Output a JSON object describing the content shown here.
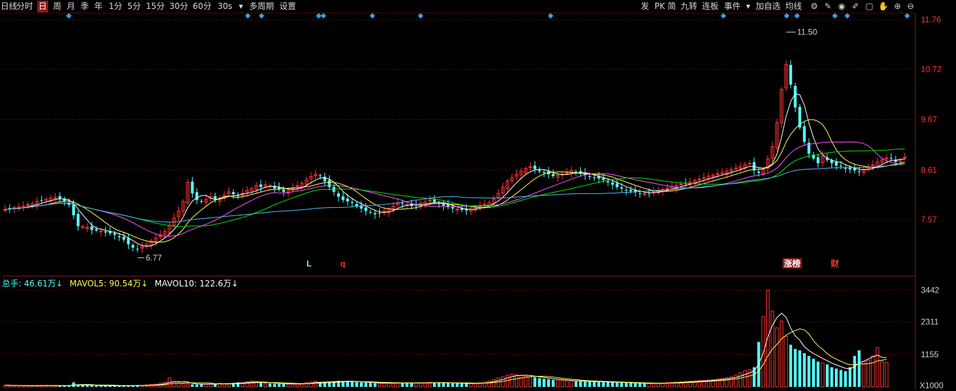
{
  "toolbar": {
    "period_buttons": [
      "日线",
      "分时",
      "日",
      "周",
      "月",
      "季",
      "年",
      "1分",
      "5分",
      "15分",
      "30分",
      "60分",
      "30s"
    ],
    "active_period": "日",
    "dropdown_arrow": "▾",
    "multi_period": "多周期",
    "settings": "设置",
    "right_buttons": [
      "发",
      "PK",
      "简",
      "九转",
      "连板",
      "事件"
    ],
    "add_watchlist": "加自选",
    "ma_line": "均线",
    "right_icons": [
      "settings-icon",
      "pen-icon",
      "eye-icon",
      "draw-icon",
      "box-icon",
      "hand-icon",
      "zoom-in-icon",
      "zoom-out-icon"
    ]
  },
  "colors": {
    "up": "#ff3232",
    "down": "#54ffff",
    "ma5": "#ffffff",
    "ma10": "#ffff54",
    "ma20": "#ff54ff",
    "ma30": "#00e600",
    "ma60": "#54b6ff",
    "grid": "#7a0000",
    "axis_text": "#ff3232"
  },
  "chart_data": {
    "type": "candlestick",
    "price_axis": {
      "ticks": [
        "11.76",
        "10.72",
        "9.67",
        "8.61",
        "7.57"
      ],
      "values": [
        11.76,
        10.72,
        9.67,
        8.61,
        7.57
      ],
      "ylim": [
        6.5,
        11.9
      ]
    },
    "annotations": {
      "high_label": "11.50",
      "high_value": 11.5,
      "low_label": "6.77",
      "low_value": 6.77
    },
    "markers": [
      {
        "text": "L",
        "color": "#54ffff"
      },
      {
        "text": "q",
        "color": "#ff3232"
      },
      {
        "text": "涨榜",
        "color": "#ffffff",
        "bg": "#8b1a1a"
      },
      {
        "text": "财",
        "color": "#ff3232"
      }
    ],
    "volume_header": {
      "total": "总手: 46.61万↓",
      "mavol5": "MAVOL5: 90.54万↓",
      "mavol10": "MAVOL10: 122.6万↓"
    },
    "volume_axis": {
      "ticks": [
        "3442",
        "2311",
        "1155"
      ],
      "values": [
        3442,
        2311,
        1155
      ],
      "unit": "X1000",
      "ylim": [
        0,
        3600
      ]
    },
    "close": [
      7.78,
      7.8,
      7.82,
      7.83,
      7.85,
      7.88,
      7.9,
      7.95,
      7.97,
      7.99,
      8.02,
      8.03,
      8.01,
      7.96,
      7.88,
      7.66,
      7.43,
      7.42,
      7.4,
      7.35,
      7.34,
      7.33,
      7.3,
      7.28,
      7.25,
      7.2,
      7.15,
      7.05,
      6.98,
      6.95,
      7.0,
      7.05,
      7.12,
      7.18,
      7.25,
      7.32,
      7.45,
      7.6,
      7.75,
      7.95,
      8.35,
      8.12,
      7.98,
      7.95,
      7.99,
      8.05,
      7.98,
      8.02,
      8.08,
      8.15,
      8.1,
      8.06,
      8.12,
      8.18,
      8.22,
      8.28,
      8.25,
      8.3,
      8.28,
      8.22,
      8.2,
      8.15,
      8.18,
      8.24,
      8.28,
      8.33,
      8.4,
      8.47,
      8.52,
      8.48,
      8.37,
      8.25,
      8.15,
      8.05,
      7.98,
      7.95,
      7.92,
      7.85,
      7.8,
      7.75,
      7.72,
      7.68,
      7.7,
      7.75,
      7.8,
      7.85,
      7.92,
      7.9,
      7.88,
      7.85,
      7.87,
      7.91,
      7.94,
      7.98,
      7.94,
      7.9,
      7.86,
      7.83,
      7.8,
      7.79,
      7.77,
      7.76,
      7.79,
      7.83,
      7.86,
      7.89,
      7.92,
      8.0,
      8.12,
      8.25,
      8.38,
      8.45,
      8.52,
      8.58,
      8.64,
      8.68,
      8.63,
      8.58,
      8.55,
      8.52,
      8.48,
      8.5,
      8.52,
      8.55,
      8.6,
      8.57,
      8.53,
      8.5,
      8.47,
      8.45,
      8.43,
      8.4,
      8.35,
      8.3,
      8.25,
      8.22,
      8.18,
      8.16,
      8.14,
      8.12,
      8.11,
      8.13,
      8.16,
      8.18,
      8.2,
      8.23,
      8.26,
      8.29,
      8.31,
      8.33,
      8.36,
      8.39,
      8.42,
      8.45,
      8.48,
      8.5,
      8.53,
      8.55,
      8.58,
      8.62,
      8.65,
      8.68,
      8.72,
      8.75,
      8.6,
      8.55,
      8.62,
      8.84,
      9.1,
      9.6,
      10.3,
      10.82,
      10.4,
      9.92,
      9.5,
      9.2,
      8.95,
      8.85,
      8.75,
      8.9,
      8.82,
      8.75,
      8.7,
      8.68,
      8.65,
      8.62,
      8.6,
      8.58,
      8.62,
      8.68,
      8.72,
      8.78,
      8.82,
      8.86,
      8.85,
      8.78,
      8.83,
      8.88
    ],
    "volume": [
      60,
      50,
      45,
      40,
      38,
      42,
      40,
      45,
      50,
      55,
      48,
      42,
      40,
      45,
      60,
      160,
      80,
      60,
      55,
      50,
      45,
      42,
      40,
      38,
      40,
      42,
      45,
      50,
      60,
      55,
      50,
      70,
      80,
      100,
      130,
      170,
      320,
      190,
      150,
      110,
      95,
      90,
      85,
      110,
      95,
      100,
      110,
      130,
      120,
      115,
      140,
      160,
      150,
      190,
      210,
      180,
      140,
      130,
      125,
      110,
      105,
      100,
      95,
      100,
      110,
      120,
      150,
      180,
      200,
      170,
      160,
      180,
      200,
      220,
      210,
      190,
      180,
      170,
      160,
      150,
      140,
      130,
      125,
      130,
      135,
      140,
      150,
      145,
      140,
      130,
      135,
      145,
      150,
      160,
      155,
      150,
      145,
      140,
      130,
      125,
      120,
      115,
      120,
      130,
      145,
      175,
      210,
      260,
      320,
      360,
      420,
      450,
      430,
      400,
      380,
      360,
      340,
      310,
      290,
      270,
      250,
      240,
      230,
      220,
      210,
      200,
      195,
      190,
      185,
      180,
      175,
      170,
      165,
      160,
      150,
      145,
      140,
      135,
      130,
      125,
      120,
      120,
      125,
      130,
      140,
      150,
      160,
      170,
      180,
      190,
      200,
      210,
      220,
      230,
      240,
      260,
      280,
      300,
      330,
      360,
      420,
      500,
      580,
      620,
      700,
      1600,
      2500,
      3442,
      2700,
      2100,
      2350,
      1800,
      1500,
      1350,
      1300,
      1200,
      1100,
      1000,
      900,
      850,
      800,
      700,
      650,
      600,
      560,
      700,
      1100,
      1300,
      900,
      950,
      1100,
      1400,
      900,
      870
    ]
  }
}
